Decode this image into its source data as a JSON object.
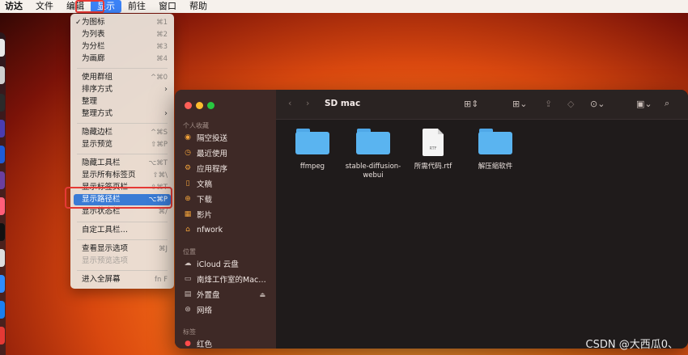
{
  "menubar": {
    "items": [
      "访达",
      "文件",
      "编辑",
      "显示",
      "前往",
      "窗口",
      "帮助"
    ]
  },
  "menu": {
    "items": [
      {
        "label": "为图标",
        "shortcut": "⌘1",
        "check": "✓"
      },
      {
        "label": "为列表",
        "shortcut": "⌘2"
      },
      {
        "label": "为分栏",
        "shortcut": "⌘3"
      },
      {
        "label": "为画廊",
        "shortcut": "⌘4"
      },
      {
        "label": "使用群组",
        "shortcut": "^⌘0"
      },
      {
        "label": "排序方式",
        "arrow": "›"
      },
      {
        "label": "整理"
      },
      {
        "label": "整理方式",
        "arrow": "›"
      },
      {
        "label": "隐藏边栏",
        "shortcut": "^⌘S"
      },
      {
        "label": "显示预览",
        "shortcut": "⇧⌘P"
      },
      {
        "label": "隐藏工具栏",
        "shortcut": "⌥⌘T"
      },
      {
        "label": "显示所有标签页",
        "shortcut": "⇧⌘\\"
      },
      {
        "label": "显示标签页栏",
        "shortcut": "⇧⌘T"
      },
      {
        "label": "显示路径栏",
        "shortcut": "⌥⌘P"
      },
      {
        "label": "显示状态栏",
        "shortcut": "⌘/"
      },
      {
        "label": "自定工具栏…"
      },
      {
        "label": "查看显示选项",
        "shortcut": "⌘J"
      },
      {
        "label": "显示预览选项"
      },
      {
        "label": "进入全屏幕",
        "shortcut": "fn F"
      }
    ]
  },
  "finder": {
    "title": "SD mac",
    "sidebar": {
      "sections": [
        "个人收藏",
        "位置",
        "标签"
      ],
      "favorites": [
        "隔空投送",
        "最近使用",
        "应用程序",
        "文稿",
        "下载",
        "影片",
        "nfwork"
      ],
      "locations": [
        "iCloud 云盘",
        "南烽工作室的Mac…",
        "外置盘",
        "网络"
      ],
      "tags": [
        "红色"
      ]
    },
    "files": [
      {
        "name": "ffmpeg",
        "kind": "folder"
      },
      {
        "name": "stable-diffusion-webui",
        "kind": "folder"
      },
      {
        "name": "所需代码.rtf",
        "kind": "doc",
        "badge": "RTF"
      },
      {
        "name": "解压缩软件",
        "kind": "folder"
      }
    ]
  },
  "watermark": "CSDN @大西瓜0、",
  "colors": {
    "accent": "#3a7bd5",
    "highlight": "#e53935",
    "folder": "#5ab4f0"
  }
}
